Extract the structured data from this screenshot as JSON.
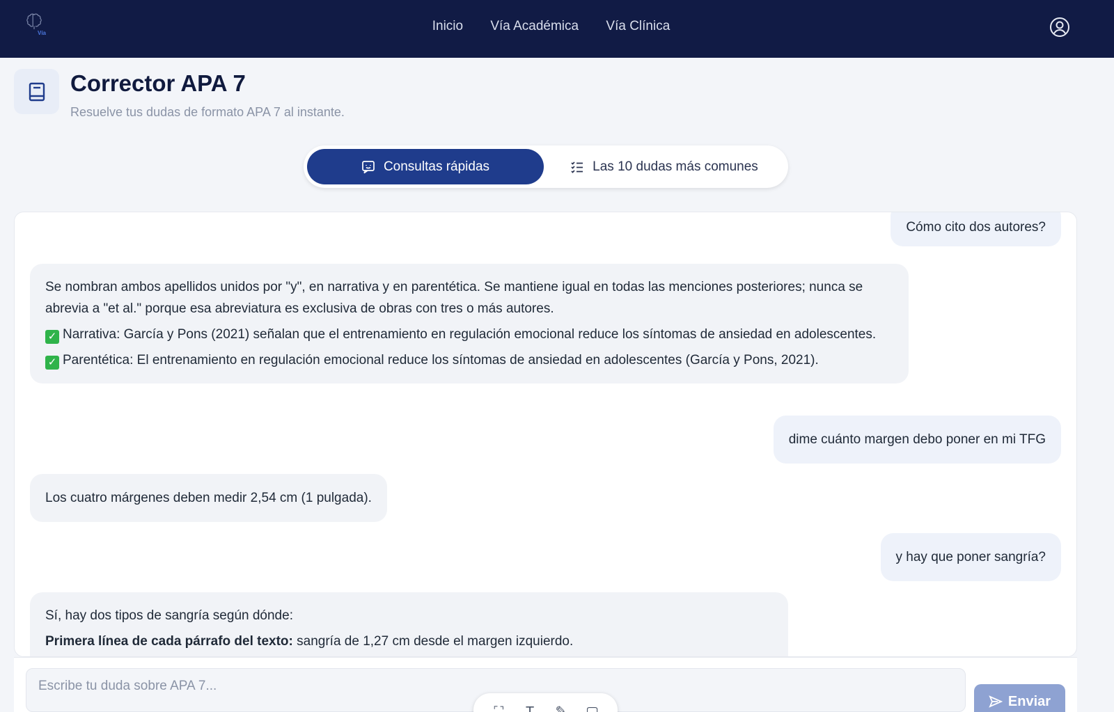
{
  "nav": {
    "logo_text": "Vía",
    "links": [
      "Inicio",
      "Vía Académica",
      "Vía Clínica"
    ]
  },
  "header": {
    "title": "Corrector APA 7",
    "subtitle": "Resuelve tus dudas de formato APA 7 al instante."
  },
  "tabs": {
    "quick": "Consultas rápidas",
    "faq": "Las 10 dudas más comunes"
  },
  "messages": {
    "u1": "Cómo cito dos autores?",
    "b1_p1": "Se nombran ambos apellidos unidos por \"y\", en narrativa y en parentética. Se mantiene igual en todas las menciones posteriores; nunca se abrevia a \"et al.\" porque esa abreviatura es exclusiva de obras con tres o más autores.",
    "b1_p2": "Narrativa: García y Pons (2021) señalan que el entrenamiento en regulación emocional reduce los síntomas de ansiedad en adolescentes.",
    "b1_p3": "Parentética: El entrenamiento en regulación emocional reduce los síntomas de ansiedad en adolescentes (García y Pons, 2021).",
    "u2": "dime cuánto margen debo poner en mi TFG",
    "b2": "Los cuatro márgenes deben medir 2,54 cm (1 pulgada).",
    "u3": "y hay que poner sangría?",
    "b3_p1": "Sí, hay dos tipos de sangría según dónde:",
    "b3_p2_bold": "Primera línea de cada párrafo del texto:",
    "b3_p2_rest": " sangría de 1,27 cm desde el margen izquierdo."
  },
  "composer": {
    "placeholder": "Escribe tu duda sobre APA 7...",
    "send_label": "Enviar"
  },
  "colors": {
    "topbar": "#111b45",
    "accent": "#1f3c8c",
    "send_disabled": "#8ea2d2"
  }
}
